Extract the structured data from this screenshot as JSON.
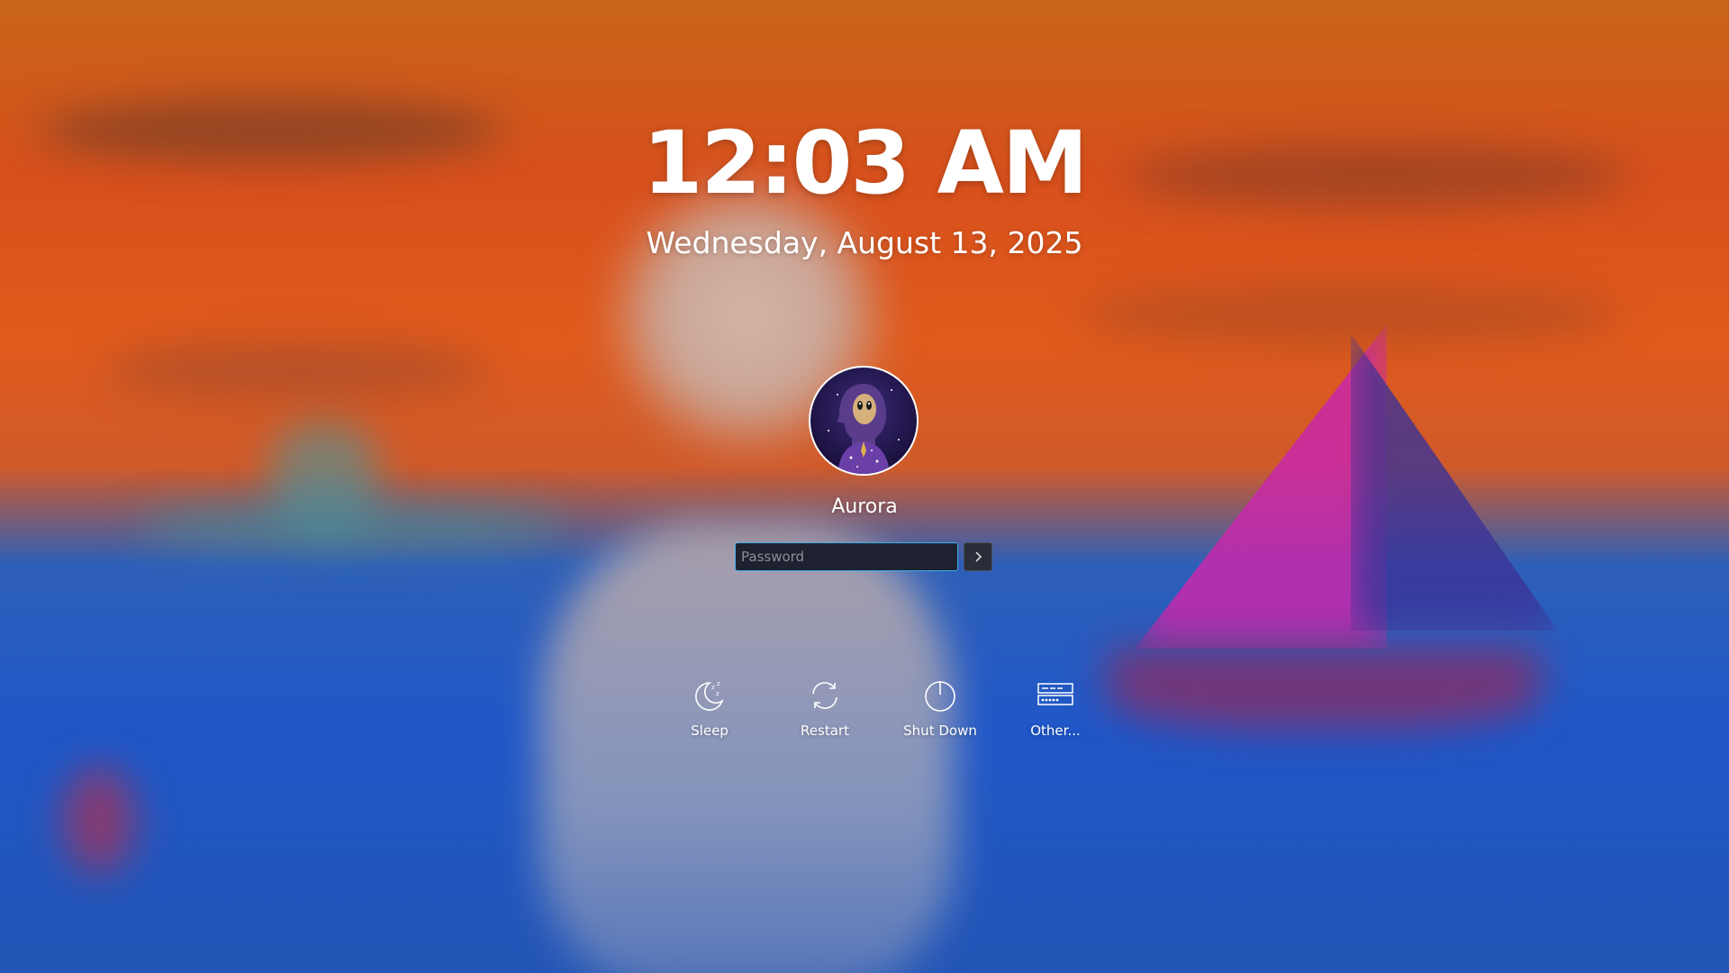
{
  "lockscreen": {
    "time": "12:03 AM",
    "date": "Wednesday, August 13, 2025",
    "user": {
      "name": "Aurora"
    },
    "password": {
      "placeholder": "Password",
      "value": ""
    },
    "actions": [
      {
        "label": "Sleep",
        "icon": "sleep-icon"
      },
      {
        "label": "Restart",
        "icon": "restart-icon"
      },
      {
        "label": "Shut Down",
        "icon": "shutdown-icon"
      },
      {
        "label": "Other...",
        "icon": "other-users-icon"
      }
    ]
  },
  "colors": {
    "accent": "#3daee9",
    "text": "#ffffff",
    "input_bg": "#1e2230"
  }
}
